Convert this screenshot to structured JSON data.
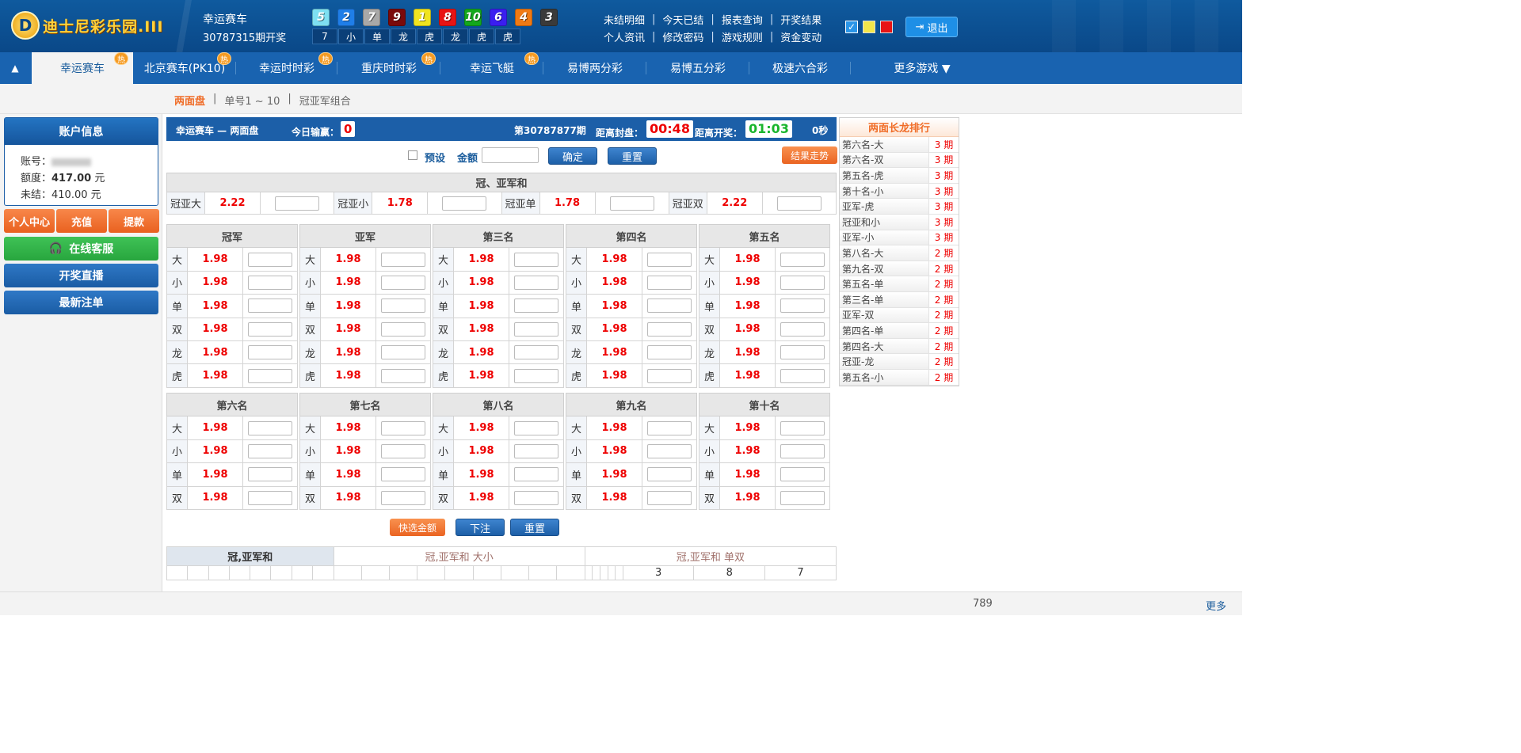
{
  "header": {
    "logo_text": "迪士尼彩乐园.III",
    "game_name": "幸运赛车",
    "period_open": "30787315期开奖",
    "balls": [
      {
        "n": "5",
        "color": "#7ee0f2"
      },
      {
        "n": "2",
        "color": "#1f7ee8"
      },
      {
        "n": "7",
        "color": "#a8a8a8"
      },
      {
        "n": "9",
        "color": "#7a0a0a"
      },
      {
        "n": "1",
        "color": "#f0e420"
      },
      {
        "n": "8",
        "color": "#e81414"
      },
      {
        "n": "10",
        "color": "#13a81c"
      },
      {
        "n": "6",
        "color": "#3a1ef0"
      },
      {
        "n": "4",
        "color": "#f07a14"
      },
      {
        "n": "3",
        "color": "#3a3a3a"
      }
    ],
    "ball_labels": [
      "7",
      "小",
      "单",
      "龙",
      "虎",
      "龙",
      "虎",
      "虎"
    ],
    "links_row1": [
      "未结明细",
      "今天已结",
      "报表查询",
      "开奖结果"
    ],
    "links_row2": [
      "个人资讯",
      "修改密码",
      "游戏规则",
      "资金变动"
    ],
    "logout": "退出"
  },
  "nav": {
    "tabs": [
      {
        "label": "幸运赛车",
        "hot": "热"
      },
      {
        "label": "北京赛车(PK10)",
        "hot": "热"
      },
      {
        "label": "幸运时时彩",
        "hot": "热"
      },
      {
        "label": "重庆时时彩",
        "hot": "热"
      },
      {
        "label": "幸运飞艇",
        "hot": "热"
      },
      {
        "label": "易博两分彩"
      },
      {
        "label": "易博五分彩"
      },
      {
        "label": "极速六合彩"
      },
      {
        "label": "更多游戏 ▼"
      }
    ]
  },
  "subnav": {
    "items": [
      "两面盘",
      "单号1 ~ 10",
      "冠亚军组合"
    ],
    "sep": "|"
  },
  "account": {
    "title": "账户信息",
    "account_label": "账号：",
    "quota_label": "额度：",
    "quota_value": "417.00",
    "quota_unit": "元",
    "unsettled_label": "未结：",
    "unsettled_value": "410.00 元",
    "buttons": [
      "个人中心",
      "充值",
      "提款"
    ],
    "service": "在线客服",
    "live": "开奖直播",
    "latest": "最新注单"
  },
  "bar": {
    "title": "幸运赛车 — 两面盘",
    "today_label": "今日输赢：",
    "today_value": "0",
    "period": "第30787877期",
    "close_label": "距离封盘：",
    "close_time": "00:48",
    "open_label": "距离开奖：",
    "open_time": "01:03",
    "seconds": "0秒"
  },
  "controls": {
    "preset": "预设",
    "amount": "金额",
    "confirm": "确定",
    "reset": "重置",
    "trend": "结果走势"
  },
  "sum": {
    "title": "冠、亚军和",
    "items": [
      {
        "label": "冠亚大",
        "odds": "2.22"
      },
      {
        "label": "冠亚小",
        "odds": "1.78"
      },
      {
        "label": "冠亚单",
        "odds": "1.78"
      },
      {
        "label": "冠亚双",
        "odds": "2.22"
      }
    ]
  },
  "groups_top": [
    {
      "title": "冠军",
      "rows": [
        {
          "k": "大",
          "o": "1.98"
        },
        {
          "k": "小",
          "o": "1.98"
        },
        {
          "k": "单",
          "o": "1.98"
        },
        {
          "k": "双",
          "o": "1.98"
        },
        {
          "k": "龙",
          "o": "1.98"
        },
        {
          "k": "虎",
          "o": "1.98"
        }
      ]
    },
    {
      "title": "亚军",
      "rows": [
        {
          "k": "大",
          "o": "1.98"
        },
        {
          "k": "小",
          "o": "1.98"
        },
        {
          "k": "单",
          "o": "1.98"
        },
        {
          "k": "双",
          "o": "1.98"
        },
        {
          "k": "龙",
          "o": "1.98"
        },
        {
          "k": "虎",
          "o": "1.98"
        }
      ]
    },
    {
      "title": "第三名",
      "rows": [
        {
          "k": "大",
          "o": "1.98"
        },
        {
          "k": "小",
          "o": "1.98"
        },
        {
          "k": "单",
          "o": "1.98"
        },
        {
          "k": "双",
          "o": "1.98"
        },
        {
          "k": "龙",
          "o": "1.98"
        },
        {
          "k": "虎",
          "o": "1.98"
        }
      ]
    },
    {
      "title": "第四名",
      "rows": [
        {
          "k": "大",
          "o": "1.98"
        },
        {
          "k": "小",
          "o": "1.98"
        },
        {
          "k": "单",
          "o": "1.98"
        },
        {
          "k": "双",
          "o": "1.98"
        },
        {
          "k": "龙",
          "o": "1.98"
        },
        {
          "k": "虎",
          "o": "1.98"
        }
      ]
    },
    {
      "title": "第五名",
      "rows": [
        {
          "k": "大",
          "o": "1.98"
        },
        {
          "k": "小",
          "o": "1.98"
        },
        {
          "k": "单",
          "o": "1.98"
        },
        {
          "k": "双",
          "o": "1.98"
        },
        {
          "k": "龙",
          "o": "1.98"
        },
        {
          "k": "虎",
          "o": "1.98"
        }
      ]
    }
  ],
  "groups_bottom": [
    {
      "title": "第六名",
      "rows": [
        {
          "k": "大",
          "o": "1.98"
        },
        {
          "k": "小",
          "o": "1.98"
        },
        {
          "k": "单",
          "o": "1.98"
        },
        {
          "k": "双",
          "o": "1.98"
        }
      ]
    },
    {
      "title": "第七名",
      "rows": [
        {
          "k": "大",
          "o": "1.98"
        },
        {
          "k": "小",
          "o": "1.98"
        },
        {
          "k": "单",
          "o": "1.98"
        },
        {
          "k": "双",
          "o": "1.98"
        }
      ]
    },
    {
      "title": "第八名",
      "rows": [
        {
          "k": "大",
          "o": "1.98"
        },
        {
          "k": "小",
          "o": "1.98"
        },
        {
          "k": "单",
          "o": "1.98"
        },
        {
          "k": "双",
          "o": "1.98"
        }
      ]
    },
    {
      "title": "第九名",
      "rows": [
        {
          "k": "大",
          "o": "1.98"
        },
        {
          "k": "小",
          "o": "1.98"
        },
        {
          "k": "单",
          "o": "1.98"
        },
        {
          "k": "双",
          "o": "1.98"
        }
      ]
    },
    {
      "title": "第十名",
      "rows": [
        {
          "k": "大",
          "o": "1.98"
        },
        {
          "k": "小",
          "o": "1.98"
        },
        {
          "k": "单",
          "o": "1.98"
        },
        {
          "k": "双",
          "o": "1.98"
        }
      ]
    }
  ],
  "bottom_buttons": {
    "quick": "快选金额",
    "submit": "下注",
    "reset": "重置"
  },
  "road": {
    "tabs": [
      "冠,亚军和",
      "冠,亚军和 大小",
      "冠,亚军和 单双"
    ],
    "last_values": [
      "3",
      "8",
      "7"
    ]
  },
  "ranking": {
    "title": "两面长龙排行",
    "rows": [
      {
        "n": "第六名-大",
        "p": "3 期"
      },
      {
        "n": "第六名-双",
        "p": "3 期"
      },
      {
        "n": "第五名-虎",
        "p": "3 期"
      },
      {
        "n": "第十名-小",
        "p": "3 期"
      },
      {
        "n": "亚军-虎",
        "p": "3 期"
      },
      {
        "n": "冠亚和小",
        "p": "3 期"
      },
      {
        "n": "亚军-小",
        "p": "3 期"
      },
      {
        "n": "第八名-大",
        "p": "2 期"
      },
      {
        "n": "第九名-双",
        "p": "2 期"
      },
      {
        "n": "第五名-单",
        "p": "2 期"
      },
      {
        "n": "第三名-单",
        "p": "2 期"
      },
      {
        "n": "亚军-双",
        "p": "2 期"
      },
      {
        "n": "第四名-单",
        "p": "2 期"
      },
      {
        "n": "第四名-大",
        "p": "2 期"
      },
      {
        "n": "冠亚-龙",
        "p": "2 期"
      },
      {
        "n": "第五名-小",
        "p": "2 期"
      }
    ]
  },
  "footer": {
    "count": "789",
    "more": "更多"
  }
}
